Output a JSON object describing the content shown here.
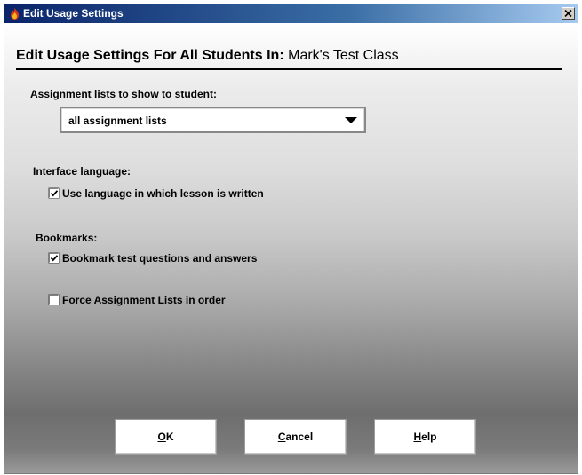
{
  "window": {
    "title": "Edit Usage Settings",
    "close_symbol": "×"
  },
  "header": {
    "prefix": "Edit Usage Settings For All Students In:",
    "class_name": "Mark's Test Class"
  },
  "assignment_lists": {
    "label": "Assignment lists to show to student:",
    "selected_value": "all assignment lists"
  },
  "interface_language": {
    "label": "Interface language:",
    "use_lesson_language": {
      "label": "Use language in which lesson is written",
      "checked": true
    }
  },
  "bookmarks": {
    "label": "Bookmarks:",
    "bookmark_test": {
      "label": "Bookmark test questions and answers",
      "checked": true
    },
    "force_order": {
      "label": "Force Assignment Lists in order",
      "checked": false
    }
  },
  "buttons": {
    "ok": {
      "mnemonic": "O",
      "rest": "K"
    },
    "cancel": {
      "mnemonic": "C",
      "rest": "ancel"
    },
    "help": {
      "mnemonic": "H",
      "rest": "elp"
    }
  },
  "icons": {
    "app": "app-flame-icon",
    "close": "close-icon",
    "dropdown": "dropdown-arrow-icon",
    "check": "checkmark-icon"
  }
}
